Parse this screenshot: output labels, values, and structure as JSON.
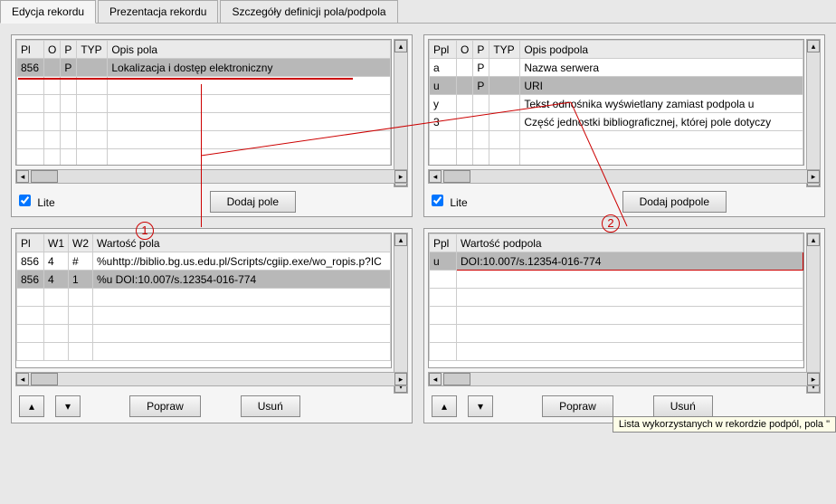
{
  "tabs": {
    "edit": "Edycja rekordu",
    "present": "Prezentacja rekordu",
    "details": "Szczegóły definicji pola/podpola"
  },
  "field_grid": {
    "headers": {
      "pl": "Pl",
      "o": "O",
      "p": "P",
      "typ": "TYP",
      "opis": "Opis pola"
    },
    "rows": [
      {
        "pl": "856",
        "o": "",
        "p": "P",
        "typ": "",
        "opis": "Lokalizacja i dostęp elektroniczny"
      }
    ]
  },
  "subfield_grid": {
    "headers": {
      "ppl": "Ppl",
      "o": "O",
      "p": "P",
      "typ": "TYP",
      "opis": "Opis podpola"
    },
    "rows": [
      {
        "ppl": "a",
        "o": "",
        "p": "P",
        "typ": "",
        "opis": "Nazwa serwera"
      },
      {
        "ppl": "u",
        "o": "",
        "p": "P",
        "typ": "",
        "opis": "URI"
      },
      {
        "ppl": "y",
        "o": "",
        "p": "",
        "typ": "",
        "opis": "Tekst odnośnika wyświetlany zamiast podpola u"
      },
      {
        "ppl": "3",
        "o": "",
        "p": "",
        "typ": "",
        "opis": "Część jednostki bibliograficznej, której pole dotyczy"
      }
    ]
  },
  "lite_label": "Lite",
  "buttons": {
    "add_field": "Dodaj pole",
    "add_subfield": "Dodaj podpole",
    "correct": "Popraw",
    "delete": "Usuń"
  },
  "field_value_grid": {
    "headers": {
      "pl": "Pl",
      "w1": "W1",
      "w2": "W2",
      "val": "Wartość pola"
    },
    "rows": [
      {
        "pl": "856",
        "w1": "4",
        "w2": "#",
        "val": "%uhttp://biblio.bg.us.edu.pl/Scripts/cgiip.exe/wo_ropis.p?IC"
      },
      {
        "pl": "856",
        "w1": "4",
        "w2": "1",
        "val": "%u DOI:10.007/s.12354-016-774"
      }
    ]
  },
  "subfield_value_grid": {
    "headers": {
      "ppl": "Ppl",
      "val": "Wartość podpola"
    },
    "rows": [
      {
        "ppl": "u",
        "val": "DOI:10.007/s.12354-016-774"
      }
    ]
  },
  "tooltip": "Lista wykorzystanych w rekordzie podpól, pola \"",
  "annotations": {
    "one": "1",
    "two": "2"
  }
}
